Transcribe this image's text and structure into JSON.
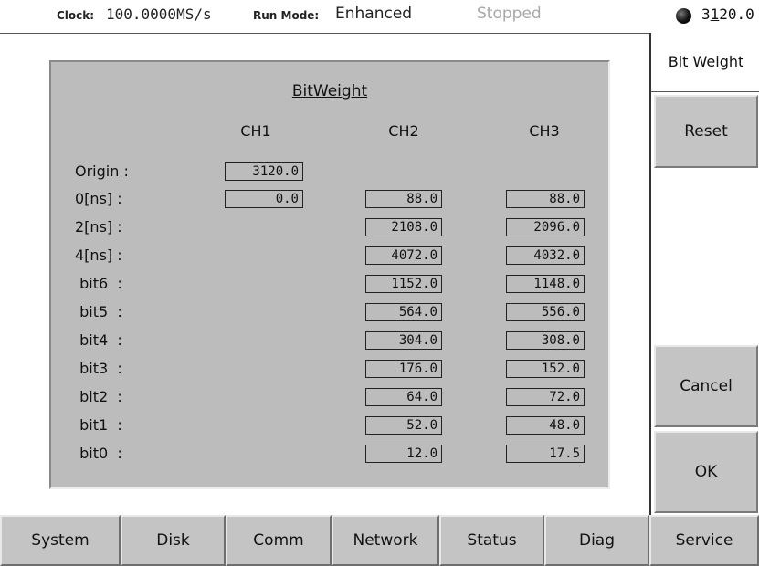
{
  "header": {
    "clock_label": "Clock:",
    "clock_value": "100.0000MS/s",
    "run_mode_label": "Run Mode:",
    "run_mode_value": "Enhanced",
    "state": "Stopped",
    "readout_a": "3",
    "readout_b": "1",
    "readout_c": "20.0"
  },
  "side_menu": {
    "title": "Bit Weight",
    "reset": "Reset",
    "cancel": "Cancel",
    "ok": "OK"
  },
  "panel": {
    "title": "BitWeight",
    "columns": [
      "CH1",
      "CH2",
      "CH3"
    ],
    "origin_label": "Origin :",
    "origin_value": "3120.0",
    "rows": [
      {
        "label": "0[ns] :",
        "ch1": "0.0",
        "ch2": "88.0",
        "ch3": "88.0"
      },
      {
        "label": "2[ns] :",
        "ch2": "2108.0",
        "ch3": "2096.0"
      },
      {
        "label": "4[ns] :",
        "ch2": "4072.0",
        "ch3": "4032.0"
      },
      {
        "label": " bit6  :",
        "ch2": "1152.0",
        "ch3": "1148.0"
      },
      {
        "label": " bit5  :",
        "ch2": "564.0",
        "ch3": "556.0"
      },
      {
        "label": " bit4  :",
        "ch2": "304.0",
        "ch3": "308.0"
      },
      {
        "label": " bit3  :",
        "ch2": "176.0",
        "ch3": "152.0"
      },
      {
        "label": " bit2  :",
        "ch2": "64.0",
        "ch3": "72.0"
      },
      {
        "label": " bit1  :",
        "ch2": "52.0",
        "ch3": "48.0"
      },
      {
        "label": " bit0  :",
        "ch2": "12.0",
        "ch3": "17.5"
      }
    ]
  },
  "bottom_tabs": [
    "System",
    "Disk",
    "Comm",
    "Network",
    "Status",
    "Diag",
    "Service"
  ]
}
